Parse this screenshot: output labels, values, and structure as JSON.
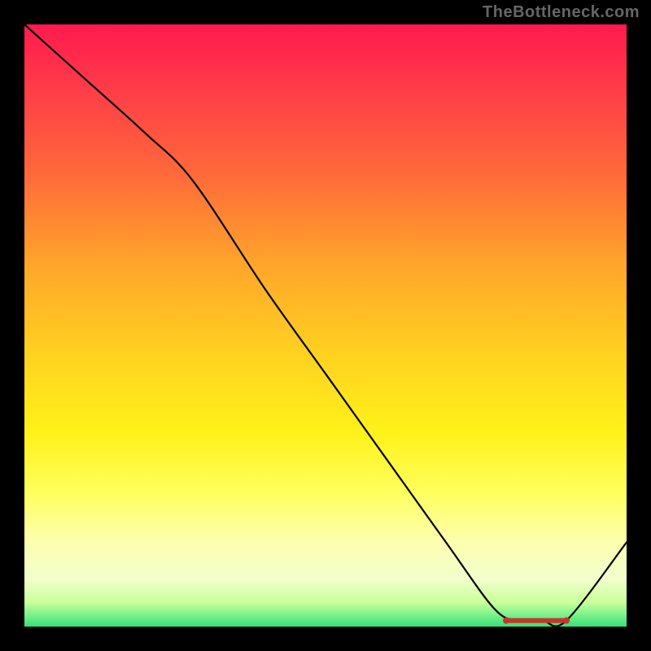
{
  "watermark": "TheBottleneck.com",
  "colors": {
    "gradient_top": "#ff1a4f",
    "gradient_mid": "#fff21a",
    "gradient_bottom": "#34e27a",
    "curve": "#000000",
    "marker": "#c7362b",
    "frame": "#000000"
  },
  "chart_data": {
    "type": "line",
    "title": "",
    "xlabel": "",
    "ylabel": "",
    "xlim": [
      0,
      100
    ],
    "ylim": [
      0,
      100
    ],
    "grid": false,
    "legend": false,
    "series": [
      {
        "name": "bottleneck-curve",
        "x": [
          0,
          10,
          20,
          28,
          40,
          50,
          60,
          70,
          78,
          82,
          86,
          90,
          100
        ],
        "y": [
          100,
          91,
          82,
          74,
          56,
          42,
          28,
          14,
          3,
          1,
          1,
          1,
          14
        ]
      }
    ],
    "annotations": [
      {
        "name": "optimal-range-marker",
        "x_start": 80,
        "x_end": 90,
        "y": 1
      }
    ]
  }
}
